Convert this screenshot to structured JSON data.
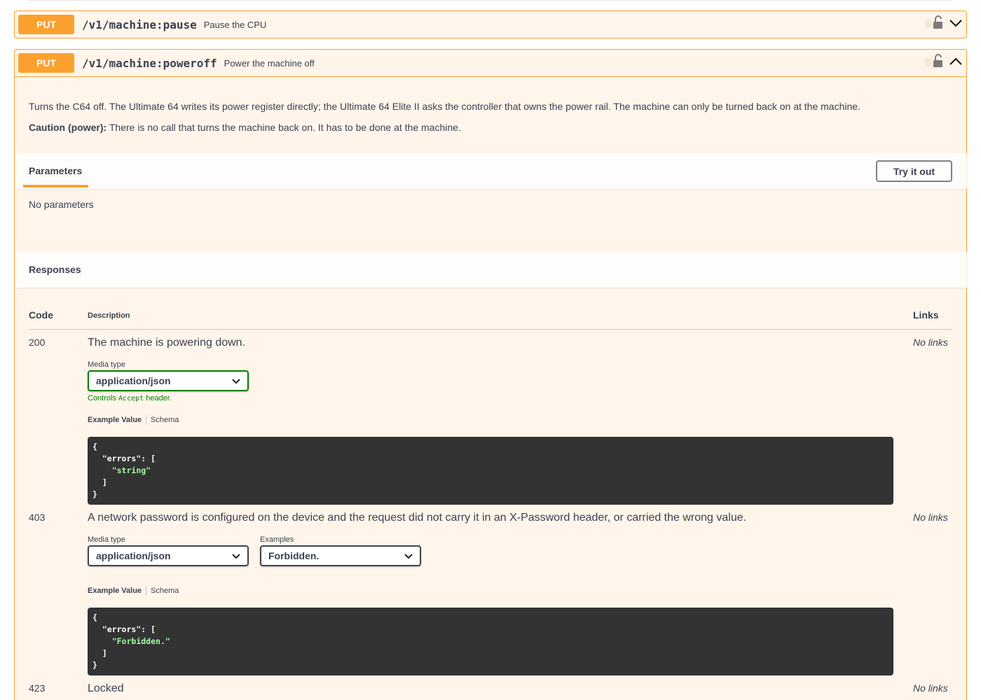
{
  "pause_op": {
    "method": "PUT",
    "path": "/v1/machine:pause",
    "summary": "Pause the CPU"
  },
  "poweroff_op": {
    "method": "PUT",
    "path": "/v1/machine:poweroff",
    "summary": "Power the machine off",
    "description": "Turns the C64 off. The Ultimate 64 writes its power register directly; the Ultimate 64 Elite II asks the controller that owns the power rail. The machine can only be turned back on at the machine.",
    "caution_label": "Caution (power):",
    "caution_text": " There is no call that turns the machine back on. It has to be done at the machine."
  },
  "parameters": {
    "title": "Parameters",
    "try_button": "Try it out",
    "empty": "No parameters"
  },
  "responses": {
    "title": "Responses",
    "col_code": "Code",
    "col_description": "Description",
    "col_links": "Links",
    "items": [
      {
        "code": "200",
        "description": "The machine is powering down.",
        "links": "No links",
        "media_label": "Media type",
        "media_value": "application/json",
        "hint_prefix": "Controls ",
        "hint_code": "Accept",
        "hint_suffix": " header.",
        "tab_example": "Example Value",
        "tab_schema": "Schema",
        "example_key": "\"errors\"",
        "example_value": "\"string\""
      },
      {
        "code": "403",
        "description": "A network password is configured on the device and the request did not carry it in an X-Password header, or carried the wrong value.",
        "links": "No links",
        "media_label": "Media type",
        "media_value": "application/json",
        "examples_label": "Examples",
        "examples_value": "Forbidden.",
        "tab_example": "Example Value",
        "tab_schema": "Schema",
        "example_key": "\"errors\"",
        "example_value": "\"Forbidden.\""
      },
      {
        "code": "423",
        "description": "Locked",
        "links": "No links"
      }
    ]
  },
  "icons": {
    "lock": "lock-icon",
    "chevron_down": "chevron-down-icon",
    "chevron_up": "chevron-up-icon",
    "select_chevron": "chevron-down-icon"
  },
  "colors": {
    "put": "#fca130",
    "code_bg": "#333333",
    "string": "#a2fca2",
    "select_focus": "#008000"
  }
}
